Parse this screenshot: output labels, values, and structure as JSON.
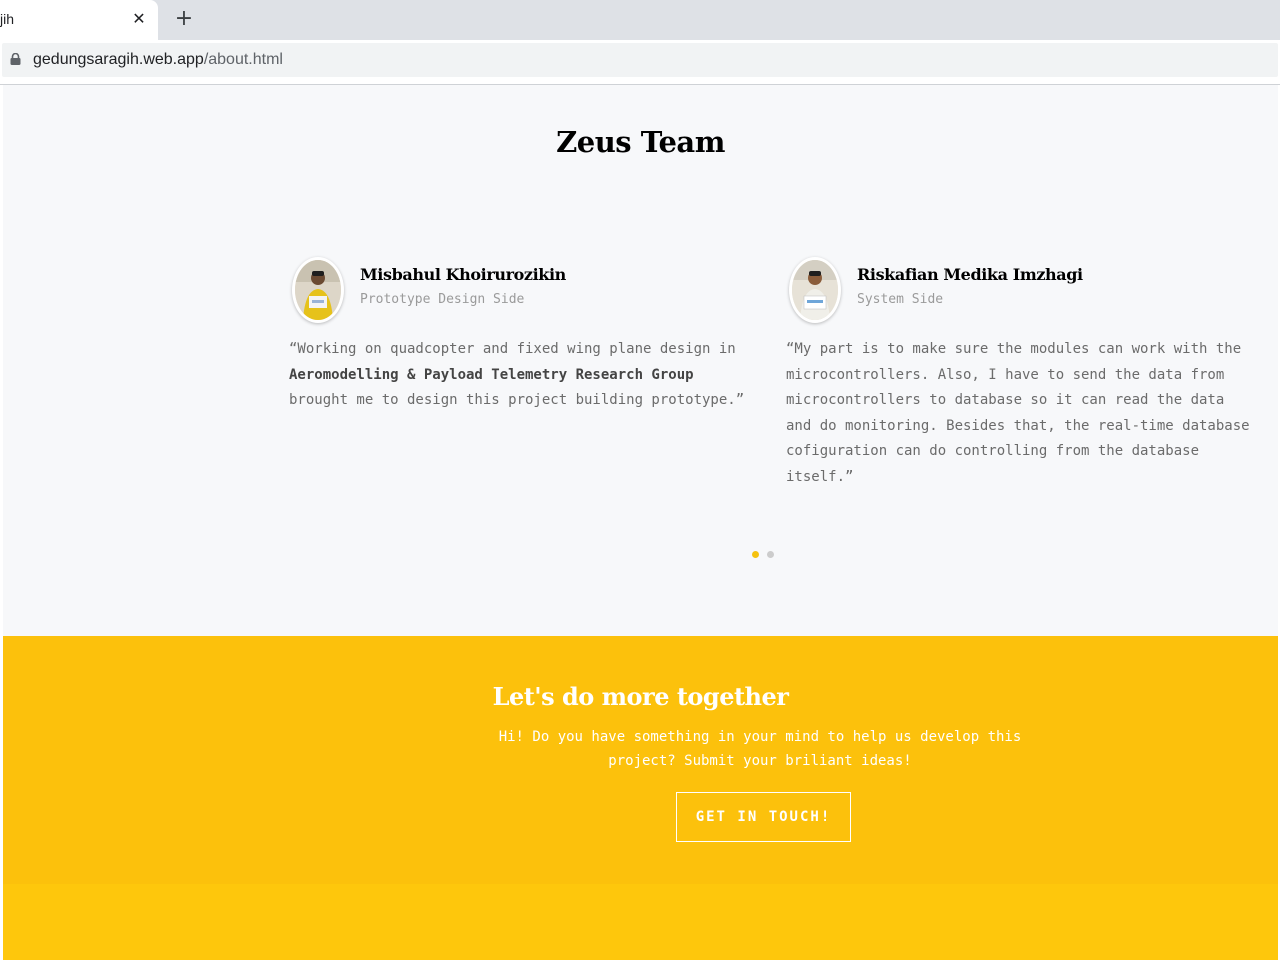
{
  "browser": {
    "tab_title": "jih",
    "url_host": "gedungsaragih.web.app",
    "url_path": "/about.html"
  },
  "team": {
    "title": "Zeus Team",
    "members": [
      {
        "name": "Misbahul Khoirurozikin",
        "role": "Prototype Design Side",
        "quote_before": "“Working on quadcopter and fixed wing plane design in ",
        "quote_bold": "Aeromodelling & Payload Telemetry Research Group",
        "quote_after": " brought me to design this project building prototype.”"
      },
      {
        "name": "Riskafian Medika Imzhagi",
        "role": "System Side",
        "quote": "“My part is to make sure the modules can work with the microcontrollers. Also, I have to send the data from microcontrollers to database so it can read the data and do monitoring. Besides that, the real-time database cofiguration can do controlling from the database itself.”"
      }
    ],
    "carousel_active_index": 0,
    "carousel_count": 2
  },
  "cta": {
    "title": "Let's do more together",
    "text": "Hi! Do you have something in your mind to help us develop this project? Submit your briliant ideas!",
    "button": "GET IN TOUCH!"
  },
  "colors": {
    "accent": "#fcc10c",
    "footer": "#fec70c",
    "page_bg": "#f7f8fa"
  }
}
